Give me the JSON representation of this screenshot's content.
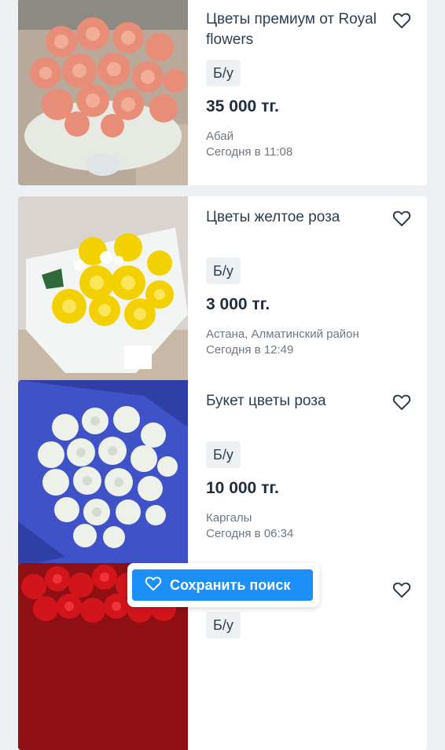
{
  "listings": [
    {
      "title": "Цветы премиум от Royal flowers",
      "condition": "Б/у",
      "price": "35 000 тг.",
      "location": "Абай",
      "date": "Сегодня в 11:08",
      "photo": "peach-roses-bouquet"
    },
    {
      "title": "Цветы желтое роза",
      "condition": "Б/у",
      "price": "3 000 тг.",
      "location": "Астана, Алматинский район",
      "date": "Сегодня в 12:49",
      "photo": "yellow-roses-bouquet"
    },
    {
      "title": "Букет цветы роза",
      "condition": "Б/у",
      "price": "10 000 тг.",
      "location": "Каргалы",
      "date": "Сегодня в 06:34",
      "photo": "white-roses-bouquet"
    },
    {
      "title": "",
      "condition": "Б/у",
      "price": "",
      "location": "",
      "date": "",
      "photo": "red-roses-bouquet"
    }
  ],
  "save_search": {
    "label": "Сохранить поиск",
    "icon": "heart-icon"
  },
  "colors": {
    "accent": "#1c8ffa",
    "text": "#2c3e50",
    "muted": "#6c7883",
    "background": "#eef1f4"
  }
}
